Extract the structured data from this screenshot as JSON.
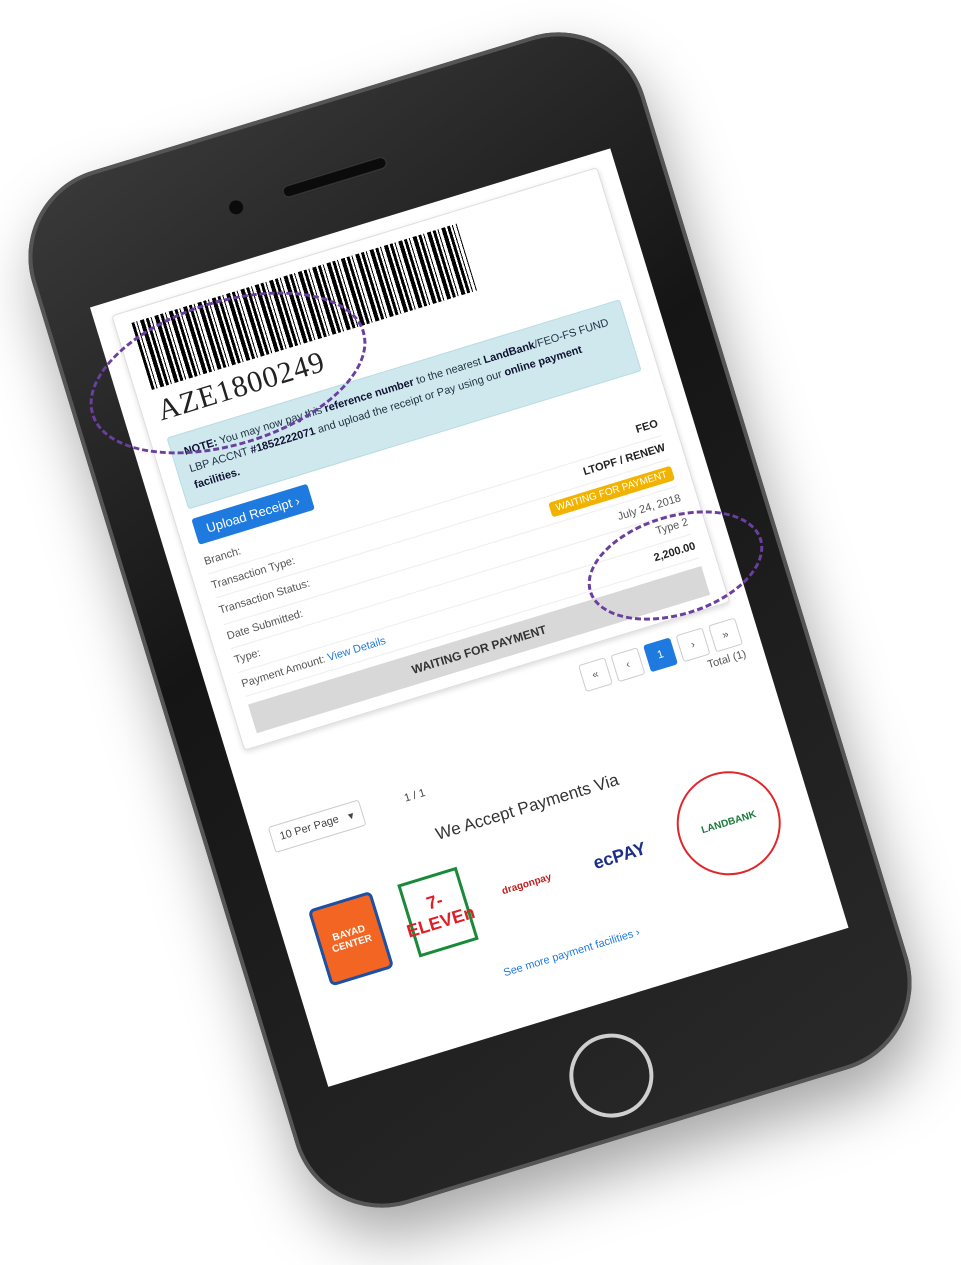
{
  "reference": {
    "number": "AZE1800249"
  },
  "note": {
    "prefix": "NOTE:",
    "text1": "You may now pay this",
    "bold1": "reference number",
    "text2": "to the nearest",
    "bold2": "LandBank",
    "text3": "/FEO-FS FUND LBP ACCNT",
    "acct": "#1852222071",
    "text4": "and upload the receipt or Pay using our",
    "bold3": "online payment facilities."
  },
  "buttons": {
    "upload_receipt": "Upload Receipt ›",
    "view_details": "View Details"
  },
  "details": {
    "branch_label": "Branch:",
    "branch_value": "FEO",
    "transaction_type_label": "Transaction Type:",
    "transaction_type_value": "LTOPF / RENEW",
    "transaction_status_label": "Transaction Status:",
    "transaction_status_value": "WAITING FOR PAYMENT",
    "date_submitted_label": "Date Submitted:",
    "date_submitted_value": "July 24, 2018",
    "type_label": "Type:",
    "type_value": "Type 2",
    "payment_amount_label": "Payment Amount:",
    "payment_amount_value": "2,200.00"
  },
  "status_bar": "WAITING FOR PAYMENT",
  "pagination": {
    "first": "«",
    "prev": "‹",
    "current": "1",
    "next": "›",
    "last": "»",
    "total": "Total (1)",
    "per_page": "10 Per Page",
    "pages": "1 / 1"
  },
  "payments": {
    "heading": "We Accept Payments Via",
    "bayad": "BAYAD CENTER",
    "seven": "7-ELEVEn",
    "dragonpay": "dragonpay",
    "ecpay": "ecPAY",
    "landbank": "LANDBANK",
    "see_more": "See more payment facilities ›"
  },
  "colors": {
    "primary": "#1f7ae0",
    "note_bg": "#cfe8ee",
    "badge": "#f2b300",
    "highlight": "#6b3fa0",
    "landbank_circle": "#e0262b"
  }
}
